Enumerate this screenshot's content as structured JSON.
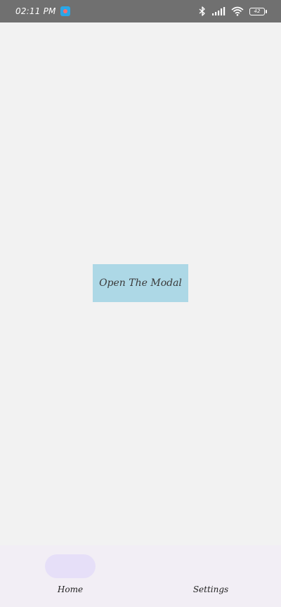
{
  "status_bar": {
    "time": "02:11 PM",
    "app_indicator_icon": "screen-recorder-icon",
    "icons": [
      "bluetooth-icon",
      "signal-icon",
      "wifi-icon",
      "battery-icon"
    ],
    "battery_level": "42"
  },
  "main": {
    "open_modal_label": "Open The Modal",
    "button_color": "#add8e6"
  },
  "bottom_nav": {
    "items": [
      {
        "label": "Home",
        "active": true
      },
      {
        "label": "Settings",
        "active": false
      }
    ],
    "active_indicator_color": "#e6dff8"
  }
}
